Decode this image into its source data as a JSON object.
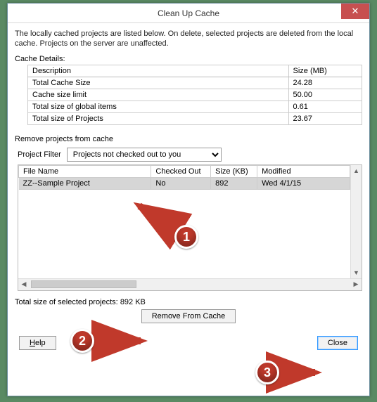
{
  "title": "Clean Up Cache",
  "intro": "The locally cached projects are listed below. On delete, selected projects are deleted from the local cache. Projects on the server are unaffected.",
  "cache_details_label": "Cache Details:",
  "cache_table": {
    "headers": {
      "desc": "Description",
      "size": "Size (MB)"
    },
    "rows": [
      {
        "desc": "Total Cache Size",
        "size": "24.28"
      },
      {
        "desc": "Cache size limit",
        "size": "50.00"
      },
      {
        "desc": "Total size of global items",
        "size": "0.61"
      },
      {
        "desc": "Total size of Projects",
        "size": "23.67"
      }
    ]
  },
  "remove_section_label": "Remove projects from cache",
  "filter_label": "Project Filter",
  "filter_value": "Projects not checked out to you",
  "projects_table": {
    "headers": {
      "file": "File Name",
      "checked": "Checked Out",
      "size": "Size (KB)",
      "modified": "Modified"
    },
    "rows": [
      {
        "file": "ZZ--Sample Project",
        "checked": "No",
        "size": "892",
        "modified": "Wed 4/1/15",
        "selected": true
      }
    ]
  },
  "total_selected_label": "Total size of selected projects:",
  "total_selected_value": "892 KB",
  "buttons": {
    "remove": "Remove From Cache",
    "help": "Help",
    "close": "Close"
  },
  "annotations": {
    "a1": "1",
    "a2": "2",
    "a3": "3"
  }
}
